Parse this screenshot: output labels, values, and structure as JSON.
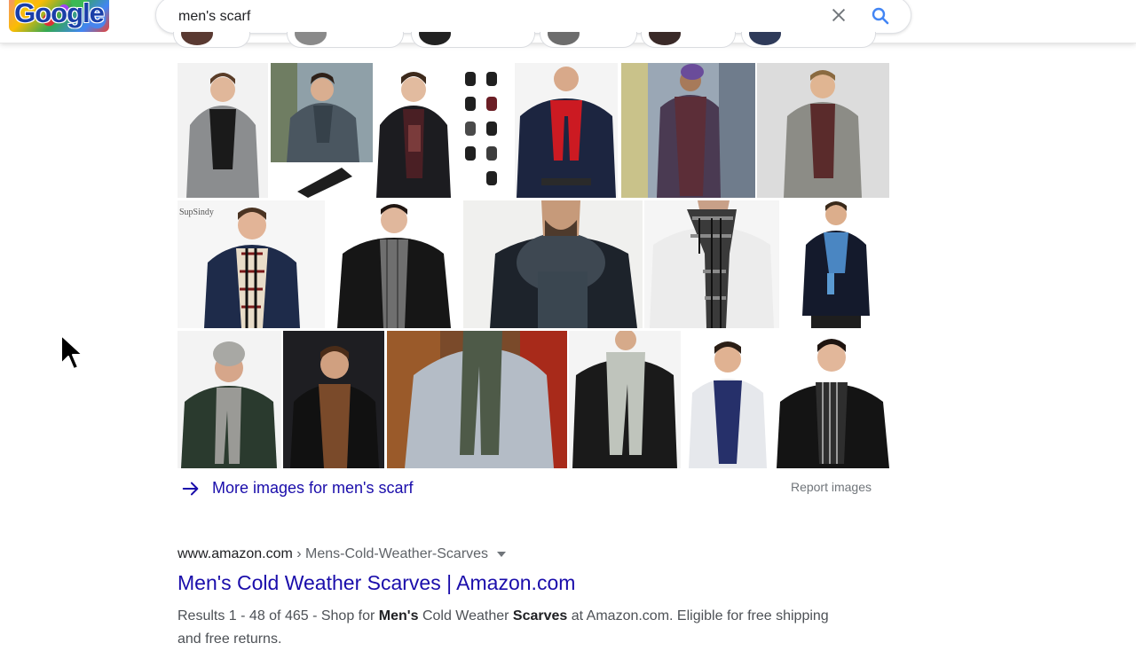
{
  "header": {
    "logo_text": "Google",
    "search": {
      "value": "men's scarf",
      "placeholder": ""
    },
    "icons": {
      "clear": "close-icon",
      "search": "search-icon"
    }
  },
  "images": {
    "more_images_label": "More images for men's scarf",
    "report_label": "Report images"
  },
  "result": {
    "domain": "www.amazon.com",
    "separator": " › ",
    "path": "Mens-Cold-Weather-Scarves",
    "title": "Men's Cold Weather Scarves | Amazon.com",
    "snippet_1": "Results 1 - 48 of 465 - Shop for ",
    "snippet_b1": "Men's",
    "snippet_2": " Cold Weather ",
    "snippet_b2": "Scarves",
    "snippet_3": " at Amazon.com. Eligible for free shipping and free returns."
  },
  "colors": {
    "link": "#1a0dab",
    "accent_search": "#4285f4",
    "text_secondary": "#70757a"
  }
}
